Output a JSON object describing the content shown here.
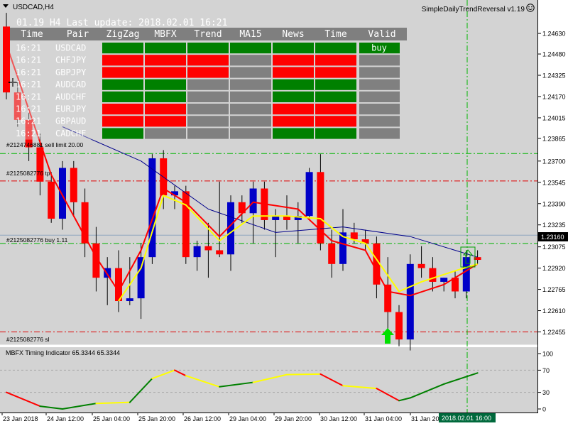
{
  "symbol_label": "USDCAD,H4",
  "indicator_name": "SimpleDailyTrendReversal v1.19",
  "indicator_status_icon": "smiley-face-icon",
  "dashboard": {
    "header_text": "01.19 H4 Last update: 2018.02.01 16:21",
    "columns": [
      "Time",
      "Pair",
      "ZigZag",
      "MBFX",
      "Trend",
      "MA15",
      "News",
      "Time",
      "Valid"
    ],
    "rows": [
      {
        "time": "16:21",
        "pair": "USDCAD",
        "cells": [
          "green",
          "green",
          "green",
          "green",
          "green",
          "green"
        ],
        "valid": "buy"
      },
      {
        "time": "16:21",
        "pair": "CHFJPY",
        "cells": [
          "red",
          "red",
          "red",
          "gray",
          "red",
          "red"
        ],
        "valid": ""
      },
      {
        "time": "16:21",
        "pair": "GBPJPY",
        "cells": [
          "red",
          "red",
          "red",
          "gray",
          "red",
          "red"
        ],
        "valid": ""
      },
      {
        "time": "16:21",
        "pair": "AUDCAD",
        "cells": [
          "green",
          "green",
          "gray",
          "gray",
          "green",
          "green"
        ],
        "valid": ""
      },
      {
        "time": "16:21",
        "pair": "AUDCHF",
        "cells": [
          "green",
          "green",
          "gray",
          "gray",
          "green",
          "green"
        ],
        "valid": ""
      },
      {
        "time": "16:21",
        "pair": "EURJPY",
        "cells": [
          "red",
          "red",
          "gray",
          "gray",
          "red",
          "red"
        ],
        "valid": ""
      },
      {
        "time": "16:21",
        "pair": "GBPAUD",
        "cells": [
          "red",
          "red",
          "gray",
          "gray",
          "red",
          "red"
        ],
        "valid": ""
      },
      {
        "time": "16:21",
        "pair": "CADCHF",
        "cells": [
          "green",
          "gray",
          "gray",
          "gray",
          "green",
          "green"
        ],
        "valid": ""
      }
    ]
  },
  "order_lines": {
    "sell_limit": "#2124746881 sell limit 20.00",
    "tp": "#2125082776 tp",
    "buy": "#2125082776 buy 1.11",
    "sl": "#2125082776 sl"
  },
  "price_axis": {
    "ticks": [
      "1.24630",
      "1.24480",
      "1.24325",
      "1.24170",
      "1.24015",
      "1.23865",
      "1.23700",
      "1.23545",
      "1.23390",
      "1.23235",
      "1.23075",
      "1.22920",
      "1.22765",
      "1.22610",
      "1.22455"
    ],
    "current_price": "1.23160"
  },
  "time_axis": {
    "labels": [
      "23 Jan 2018",
      "24 Jan 12:00",
      "25 Jan 04:00",
      "25 Jan 20:00",
      "26 Jan 12:00",
      "29 Jan 04:00",
      "29 Jan 20:00",
      "30 Jan 12:00",
      "31 Jan 04:00",
      "31 Jan 20:00"
    ],
    "current_time": "2018.02.01 16:00"
  },
  "sub_window": {
    "title": "MBFX Timing Indicator 65.3344 65.3344",
    "ticks": [
      "100",
      "70",
      "30",
      "0"
    ]
  },
  "colors": {
    "background": "#d3d3d3",
    "bull_candle": "#0000c8",
    "bear_candle": "#ff0000",
    "ma_fast": "#ff0000",
    "ma_slow": "#00008b",
    "ma_yellow": "#ffff00",
    "table_green": "#008000",
    "table_red": "#ff0000",
    "table_gray": "#808080"
  },
  "chart_data": {
    "type": "candlestick",
    "title": "USDCAD,H4",
    "ylim": [
      1.2238,
      1.2477
    ],
    "candles": [
      {
        "o": 1.2468,
        "h": 1.2478,
        "l": 1.2415,
        "c": 1.242
      },
      {
        "o": 1.242,
        "h": 1.2428,
        "l": 1.2395,
        "c": 1.24
      },
      {
        "o": 1.24,
        "h": 1.2405,
        "l": 1.237,
        "c": 1.238
      },
      {
        "o": 1.238,
        "h": 1.239,
        "l": 1.2345,
        "c": 1.2355
      },
      {
        "o": 1.2355,
        "h": 1.2362,
        "l": 1.2325,
        "c": 1.2328
      },
      {
        "o": 1.2328,
        "h": 1.237,
        "l": 1.232,
        "c": 1.2365
      },
      {
        "o": 1.2365,
        "h": 1.237,
        "l": 1.233,
        "c": 1.234
      },
      {
        "o": 1.234,
        "h": 1.235,
        "l": 1.23,
        "c": 1.231
      },
      {
        "o": 1.231,
        "h": 1.2322,
        "l": 1.2275,
        "c": 1.2285
      },
      {
        "o": 1.2285,
        "h": 1.23,
        "l": 1.2265,
        "c": 1.2292
      },
      {
        "o": 1.2292,
        "h": 1.2305,
        "l": 1.226,
        "c": 1.2268
      },
      {
        "o": 1.2268,
        "h": 1.23,
        "l": 1.2265,
        "c": 1.227
      },
      {
        "o": 1.227,
        "h": 1.231,
        "l": 1.2255,
        "c": 1.23
      },
      {
        "o": 1.23,
        "h": 1.2375,
        "l": 1.2295,
        "c": 1.2372
      },
      {
        "o": 1.2372,
        "h": 1.2378,
        "l": 1.2335,
        "c": 1.2345
      },
      {
        "o": 1.2345,
        "h": 1.2352,
        "l": 1.2335,
        "c": 1.2348
      },
      {
        "o": 1.2348,
        "h": 1.2352,
        "l": 1.2295,
        "c": 1.23
      },
      {
        "o": 1.23,
        "h": 1.2312,
        "l": 1.229,
        "c": 1.2308
      },
      {
        "o": 1.2308,
        "h": 1.2325,
        "l": 1.2285,
        "c": 1.2305
      },
      {
        "o": 1.2305,
        "h": 1.2355,
        "l": 1.23,
        "c": 1.2302
      },
      {
        "o": 1.2302,
        "h": 1.2345,
        "l": 1.229,
        "c": 1.234
      },
      {
        "o": 1.234,
        "h": 1.2345,
        "l": 1.2325,
        "c": 1.2332
      },
      {
        "o": 1.2332,
        "h": 1.2355,
        "l": 1.231,
        "c": 1.235
      },
      {
        "o": 1.235,
        "h": 1.2355,
        "l": 1.232,
        "c": 1.2327
      },
      {
        "o": 1.2327,
        "h": 1.2335,
        "l": 1.23,
        "c": 1.233
      },
      {
        "o": 1.233,
        "h": 1.2345,
        "l": 1.232,
        "c": 1.2327
      },
      {
        "o": 1.2327,
        "h": 1.234,
        "l": 1.231,
        "c": 1.233
      },
      {
        "o": 1.233,
        "h": 1.2365,
        "l": 1.2328,
        "c": 1.2362
      },
      {
        "o": 1.2362,
        "h": 1.2375,
        "l": 1.2305,
        "c": 1.231
      },
      {
        "o": 1.231,
        "h": 1.232,
        "l": 1.2285,
        "c": 1.2295
      },
      {
        "o": 1.2295,
        "h": 1.2335,
        "l": 1.229,
        "c": 1.2318
      },
      {
        "o": 1.2318,
        "h": 1.2325,
        "l": 1.231,
        "c": 1.2313
      },
      {
        "o": 1.2313,
        "h": 1.232,
        "l": 1.2305,
        "c": 1.231
      },
      {
        "o": 1.231,
        "h": 1.2315,
        "l": 1.227,
        "c": 1.228
      },
      {
        "o": 1.228,
        "h": 1.23,
        "l": 1.224,
        "c": 1.226
      },
      {
        "o": 1.226,
        "h": 1.2265,
        "l": 1.2235,
        "c": 1.224
      },
      {
        "o": 1.224,
        "h": 1.2302,
        "l": 1.2232,
        "c": 1.2295
      },
      {
        "o": 1.2295,
        "h": 1.2308,
        "l": 1.2285,
        "c": 1.2292
      },
      {
        "o": 1.2292,
        "h": 1.23,
        "l": 1.2275,
        "c": 1.2282
      },
      {
        "o": 1.2282,
        "h": 1.2285,
        "l": 1.2275,
        "c": 1.2285
      },
      {
        "o": 1.2285,
        "h": 1.229,
        "l": 1.227,
        "c": 1.2275
      },
      {
        "o": 1.2275,
        "h": 1.2305,
        "l": 1.227,
        "c": 1.23
      },
      {
        "o": 1.23,
        "h": 1.2305,
        "l": 1.2295,
        "c": 1.2298
      }
    ],
    "ma_slow": [
      {
        "i": 5,
        "v": 1.2395
      },
      {
        "i": 12,
        "v": 1.237
      },
      {
        "i": 18,
        "v": 1.2335
      },
      {
        "i": 24,
        "v": 1.2318
      },
      {
        "i": 30,
        "v": 1.2322
      },
      {
        "i": 36,
        "v": 1.2315
      },
      {
        "i": 42,
        "v": 1.23
      }
    ],
    "ma_fast": [
      {
        "i": 0,
        "v": 1.2455
      },
      {
        "i": 4,
        "v": 1.236
      },
      {
        "i": 8,
        "v": 1.23
      },
      {
        "i": 10,
        "v": 1.2275
      },
      {
        "i": 12,
        "v": 1.2305
      },
      {
        "i": 14,
        "v": 1.235
      },
      {
        "i": 16,
        "v": 1.234
      },
      {
        "i": 19,
        "v": 1.2315
      },
      {
        "i": 22,
        "v": 1.234
      },
      {
        "i": 26,
        "v": 1.2335
      },
      {
        "i": 29,
        "v": 1.2312
      },
      {
        "i": 32,
        "v": 1.2305
      },
      {
        "i": 34,
        "v": 1.2275
      },
      {
        "i": 36,
        "v": 1.2272
      },
      {
        "i": 39,
        "v": 1.228
      },
      {
        "i": 42,
        "v": 1.2295
      }
    ],
    "ma_yellow": [
      {
        "i": 10,
        "v": 1.2268
      },
      {
        "i": 12,
        "v": 1.2292
      },
      {
        "i": 14,
        "v": 1.2345
      },
      {
        "i": 16,
        "v": 1.2338
      },
      {
        "i": 19,
        "v": 1.2312
      },
      {
        "i": 22,
        "v": 1.233
      },
      {
        "i": 25,
        "v": 1.233
      },
      {
        "i": 28,
        "v": 1.2328
      },
      {
        "i": 30,
        "v": 1.2315
      },
      {
        "i": 32,
        "v": 1.231
      },
      {
        "i": 35,
        "v": 1.2275
      },
      {
        "i": 37,
        "v": 1.2282
      },
      {
        "i": 40,
        "v": 1.229
      },
      {
        "i": 42,
        "v": 1.2295
      }
    ],
    "sub_series": [
      {
        "i": 0,
        "v": 30,
        "c": "red"
      },
      {
        "i": 3,
        "v": 5,
        "c": "red"
      },
      {
        "i": 5,
        "v": 0,
        "c": "green"
      },
      {
        "i": 8,
        "v": 10,
        "c": "green"
      },
      {
        "i": 11,
        "v": 12,
        "c": "yellow"
      },
      {
        "i": 13,
        "v": 55,
        "c": "green"
      },
      {
        "i": 15,
        "v": 70,
        "c": "yellow"
      },
      {
        "i": 16,
        "v": 60,
        "c": "red"
      },
      {
        "i": 19,
        "v": 40,
        "c": "yellow"
      },
      {
        "i": 22,
        "v": 48,
        "c": "green"
      },
      {
        "i": 25,
        "v": 62,
        "c": "yellow"
      },
      {
        "i": 28,
        "v": 63,
        "c": "yellow"
      },
      {
        "i": 30,
        "v": 42,
        "c": "red"
      },
      {
        "i": 33,
        "v": 37,
        "c": "yellow"
      },
      {
        "i": 35,
        "v": 15,
        "c": "red"
      },
      {
        "i": 36,
        "v": 20,
        "c": "green"
      },
      {
        "i": 39,
        "v": 45,
        "c": "green"
      },
      {
        "i": 42,
        "v": 65,
        "c": "green"
      }
    ],
    "sub_ylim": [
      0,
      100
    ]
  }
}
